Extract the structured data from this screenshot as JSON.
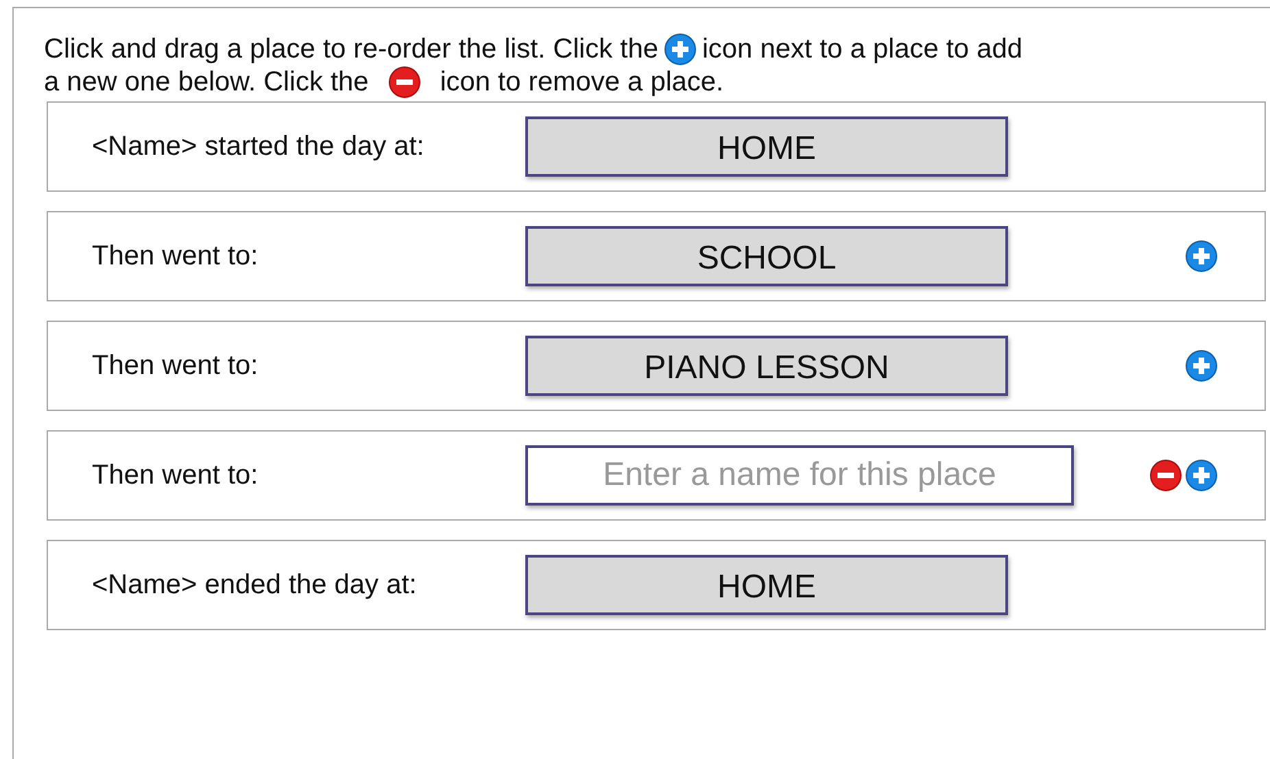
{
  "instructions": [
    [
      {
        "kind": "text",
        "text": "Click and drag a place to re-order the list. Click the"
      },
      {
        "kind": "add-icon"
      },
      {
        "kind": "text",
        "text": "icon next to a place to add"
      }
    ],
    [
      {
        "kind": "text",
        "text": "a new one below. Click the"
      },
      {
        "kind": "remove-icon"
      },
      {
        "kind": "text",
        "text": "icon to remove a place."
      }
    ]
  ],
  "places": [
    {
      "label": "<Name> started the day at:",
      "kind": "place",
      "value": "HOME",
      "can_remove": false,
      "can_add": false
    },
    {
      "label": "Then went to:",
      "kind": "place",
      "value": "SCHOOL",
      "can_remove": false,
      "can_add": true
    },
    {
      "label": "Then went to:",
      "kind": "place",
      "value": "PIANO LESSON",
      "can_remove": false,
      "can_add": true
    },
    {
      "label": "Then went to:",
      "kind": "entry",
      "placeholder": "Enter a name for this place",
      "can_remove": true,
      "can_add": true
    },
    {
      "label": "<Name> ended the day at:",
      "kind": "place",
      "value": "HOME",
      "can_remove": false,
      "can_add": false
    }
  ]
}
